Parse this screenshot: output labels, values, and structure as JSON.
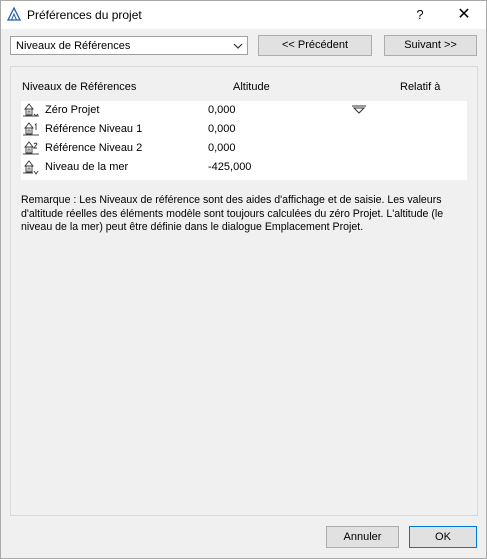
{
  "window": {
    "title": "Préférences du projet",
    "help_label": "?",
    "close_label": "✕"
  },
  "toolbar": {
    "section_value": "Niveaux de Références",
    "prev_label": "<< Précédent",
    "next_label": "Suivant >>"
  },
  "table": {
    "headers": {
      "name": "Niveaux de Références",
      "altitude": "Altitude",
      "relative": "Relatif à"
    },
    "rows": [
      {
        "name": "Zéro Projet",
        "altitude": "0,000",
        "icon": "project-zero-icon",
        "relative_marker": "triangle-down-icon"
      },
      {
        "name": "Référence Niveau 1",
        "altitude": "0,000",
        "icon": "reference-level-1-icon"
      },
      {
        "name": "Référence Niveau 2",
        "altitude": "0,000",
        "icon": "reference-level-2-icon"
      },
      {
        "name": "Niveau de la mer",
        "altitude": "-425,000",
        "icon": "sea-level-icon"
      }
    ]
  },
  "remark": "Remarque : Les Niveaux de référence sont des aides d'affichage et de saisie. Les valeurs d'altitude réelles des éléments modèle sont toujours calculées du zéro Projet. L'altitude (le niveau de la mer) peut être définie dans le dialogue Emplacement Projet.",
  "footer": {
    "cancel_label": "Annuler",
    "ok_label": "OK"
  },
  "colors": {
    "accent": "#0078d7",
    "app_icon": "#1e5fb4"
  }
}
